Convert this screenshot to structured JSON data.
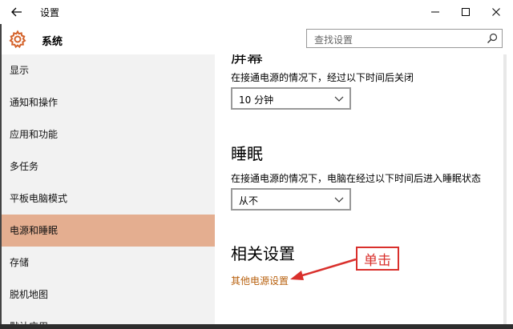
{
  "titlebar": {
    "title": "设置",
    "back_icon": "back-arrow-icon",
    "minimize_icon": "minimize-icon",
    "maximize_icon": "maximize-icon",
    "close_icon": "close-icon"
  },
  "header": {
    "app_name": "系统",
    "app_icon": "gear-icon",
    "search_placeholder": "查找设置",
    "search_icon": "search-icon"
  },
  "sidebar": {
    "items": [
      {
        "label": "显示",
        "active": false
      },
      {
        "label": "通知和操作",
        "active": false
      },
      {
        "label": "应用和功能",
        "active": false
      },
      {
        "label": "多任务",
        "active": false
      },
      {
        "label": "平板电脑模式",
        "active": false
      },
      {
        "label": "电源和睡眠",
        "active": true
      },
      {
        "label": "存储",
        "active": false
      },
      {
        "label": "脱机地图",
        "active": false
      },
      {
        "label": "默认应用",
        "active": false
      }
    ],
    "active_color": "#e4ae90"
  },
  "content": {
    "screen": {
      "heading": "屏幕",
      "description": "在接通电源的情况下，经过以下时间后关闭",
      "dropdown_value": "10 分钟"
    },
    "sleep": {
      "heading": "睡眠",
      "description": "在接通电源的情况下，电脑在经过以下时间后进入睡眠状态",
      "dropdown_value": "从不"
    },
    "related": {
      "heading": "相关设置",
      "link": "其他电源设置"
    },
    "link_color": "#b8610f"
  },
  "annotation": {
    "label": "单击",
    "color": "#d9302c"
  }
}
